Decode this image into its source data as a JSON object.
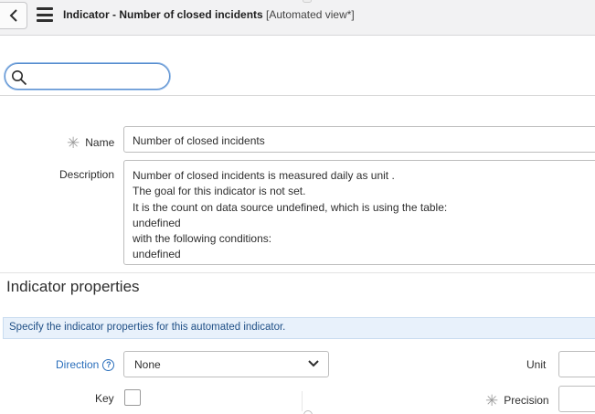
{
  "header": {
    "title": "Indicator - Number of closed incidents",
    "view_label": "[Automated view*]"
  },
  "search": {
    "value": "",
    "placeholder": ""
  },
  "form": {
    "name_label": "Name",
    "name_value": "Number of closed incidents",
    "description_label": "Description",
    "description_lines": [
      "Number of closed incidents is measured daily as unit .",
      "The goal for this indicator is not set.",
      "It is the count on data source undefined, which is using the table:",
      "undefined",
      "with the following conditions:",
      "undefined"
    ]
  },
  "properties": {
    "section_title": "Indicator properties",
    "info_message": "Specify the indicator properties for this automated indicator.",
    "direction_label": "Direction",
    "direction_value": "None",
    "unit_label": "Unit",
    "unit_value": "",
    "key_label": "Key",
    "precision_label": "Precision",
    "precision_value": ""
  },
  "colors": {
    "link_blue": "#2a6ebb",
    "info_bg": "#e8f1fb",
    "header_bg": "#f2f2f3"
  },
  "icons": {
    "back": "chevron-left-icon",
    "menu": "hamburger-menu-icon",
    "search": "search-icon",
    "help": "help-circle-icon",
    "select": "chevron-down-icon",
    "required": "asterisk-icon"
  }
}
